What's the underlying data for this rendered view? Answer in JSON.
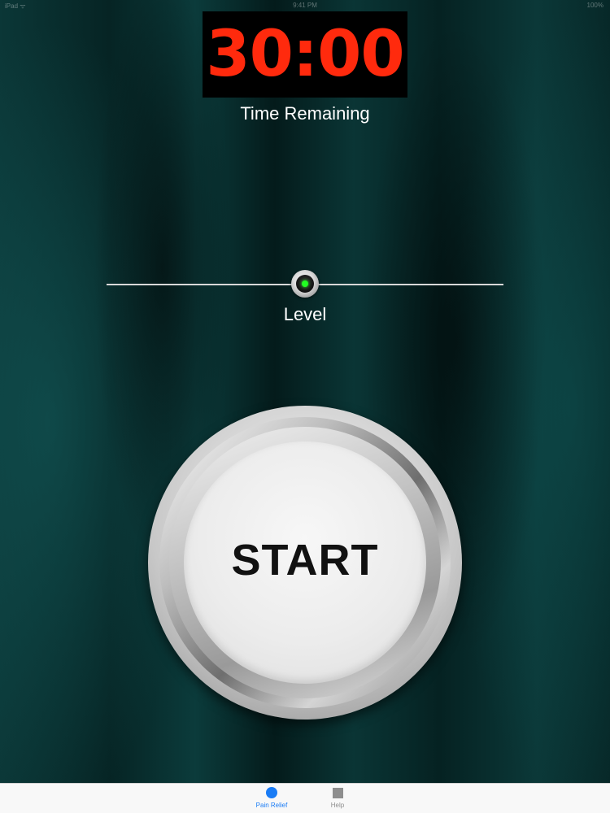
{
  "status_bar": {
    "carrier": "iPad ᯤ",
    "time": "9:41 PM",
    "battery": "100%"
  },
  "timer": {
    "display": "30:00",
    "caption": "Time Remaining",
    "display_color": "#ff2a0d"
  },
  "level_slider": {
    "caption": "Level",
    "value_fraction": 0.5,
    "indicator_color": "#22ff22"
  },
  "start_button": {
    "label": "START"
  },
  "tab_bar": {
    "accent_color": "#1a7cf5",
    "tabs": [
      {
        "label": "Pain Relief",
        "icon": "circle-icon",
        "selected": true
      },
      {
        "label": "Help",
        "icon": "square-icon",
        "selected": false
      }
    ]
  }
}
